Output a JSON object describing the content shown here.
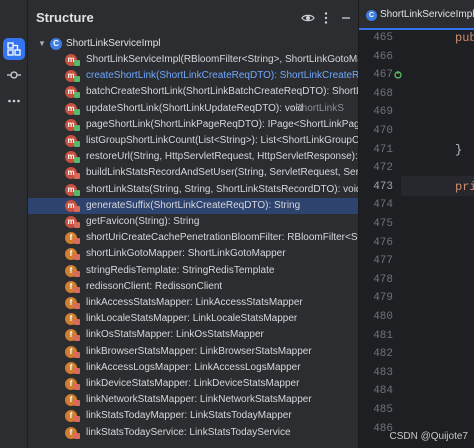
{
  "panel": {
    "title": "Structure"
  },
  "tree": {
    "root": {
      "label": "ShortLinkServiceImpl",
      "icon": "class-icon"
    },
    "items": [
      {
        "label": "ShortLinkServiceImpl(RBloomFilter<String>, ShortLinkGotoMapp",
        "icon": "method-icon",
        "kind": "m",
        "visibility": "public"
      },
      {
        "label": "createShortLink(ShortLinkCreateReqDTO): ShortLinkCreateResp",
        "icon": "method-icon",
        "kind": "m",
        "visibility": "public",
        "highlight": true
      },
      {
        "label": "batchCreateShortLink(ShortLinkBatchCreateReqDTO): ShortLink",
        "icon": "method-icon",
        "kind": "m",
        "visibility": "public"
      },
      {
        "label": "updateShortLink(ShortLinkUpdateReqDTO): void",
        "suffix": "↑ShortLinkS",
        "icon": "method-icon",
        "kind": "m",
        "visibility": "public"
      },
      {
        "label": "pageShortLink(ShortLinkPageReqDTO): IPage<ShortLinkPageRe",
        "icon": "method-icon",
        "kind": "m",
        "visibility": "public"
      },
      {
        "label": "listGroupShortLinkCount(List<String>): List<ShortLinkGroupCou",
        "icon": "method-icon",
        "kind": "m",
        "visibility": "public"
      },
      {
        "label": "restoreUrl(String, HttpServletRequest, HttpServletResponse): v",
        "icon": "method-icon",
        "kind": "m",
        "visibility": "public"
      },
      {
        "label": "buildLinkStatsRecordAndSetUser(String, ServletRequest, Servle",
        "icon": "method-icon",
        "kind": "m",
        "visibility": "private"
      },
      {
        "label": "shortLinkStats(String, String, ShortLinkStatsRecordDTO): void",
        "icon": "method-icon",
        "kind": "m",
        "visibility": "public"
      },
      {
        "label": "generateSuffix(ShortLinkCreateReqDTO): String",
        "icon": "method-icon",
        "kind": "m",
        "visibility": "private",
        "selected": true
      },
      {
        "label": "getFavicon(String): String",
        "icon": "method-icon",
        "kind": "m",
        "visibility": "private"
      },
      {
        "label": "shortUriCreateCachePenetrationBloomFilter: RBloomFilter<String",
        "icon": "field-icon",
        "kind": "f",
        "visibility": "private"
      },
      {
        "label": "shortLinkGotoMapper: ShortLinkGotoMapper",
        "icon": "field-icon",
        "kind": "f",
        "visibility": "private"
      },
      {
        "label": "stringRedisTemplate: StringRedisTemplate",
        "icon": "field-icon",
        "kind": "f",
        "visibility": "private"
      },
      {
        "label": "redissonClient: RedissonClient",
        "icon": "field-icon",
        "kind": "f",
        "visibility": "private"
      },
      {
        "label": "linkAccessStatsMapper: LinkAccessStatsMapper",
        "icon": "field-icon",
        "kind": "f",
        "visibility": "private"
      },
      {
        "label": "linkLocaleStatsMapper: LinkLocaleStatsMapper",
        "icon": "field-icon",
        "kind": "f",
        "visibility": "private"
      },
      {
        "label": "linkOsStatsMapper: LinkOsStatsMapper",
        "icon": "field-icon",
        "kind": "f",
        "visibility": "private"
      },
      {
        "label": "linkBrowserStatsMapper: LinkBrowserStatsMapper",
        "icon": "field-icon",
        "kind": "f",
        "visibility": "private"
      },
      {
        "label": "linkAccessLogsMapper: LinkAccessLogsMapper",
        "icon": "field-icon",
        "kind": "f",
        "visibility": "private"
      },
      {
        "label": "linkDeviceStatsMapper: LinkDeviceStatsMapper",
        "icon": "field-icon",
        "kind": "f",
        "visibility": "private"
      },
      {
        "label": "linkNetworkStatsMapper: LinkNetworkStatsMapper",
        "icon": "field-icon",
        "kind": "f",
        "visibility": "private"
      },
      {
        "label": "linkStatsTodayMapper: LinkStatsTodayMapper",
        "icon": "field-icon",
        "kind": "f",
        "visibility": "private"
      },
      {
        "label": "linkStatsTodayService: LinkStatsTodayService",
        "icon": "field-icon",
        "kind": "f",
        "visibility": "private"
      }
    ]
  },
  "editor": {
    "tab_label": "ShortLinkServiceImpl.ja",
    "lines": [
      {
        "num": "465",
        "code": "pub"
      },
      {
        "num": "466",
        "code": ""
      },
      {
        "num": "467",
        "code": ""
      },
      {
        "num": "468",
        "code": ""
      },
      {
        "num": "469",
        "code": ""
      },
      {
        "num": "470",
        "code": ""
      },
      {
        "num": "471",
        "code": "}"
      },
      {
        "num": "472",
        "code": ""
      },
      {
        "num": "473",
        "code": "pri"
      },
      {
        "num": "474",
        "code": ""
      },
      {
        "num": "475",
        "code": ""
      },
      {
        "num": "476",
        "code": ""
      },
      {
        "num": "477",
        "code": ""
      },
      {
        "num": "478",
        "code": ""
      },
      {
        "num": "479",
        "code": ""
      },
      {
        "num": "480",
        "code": ""
      },
      {
        "num": "481",
        "code": ""
      },
      {
        "num": "482",
        "code": ""
      },
      {
        "num": "483",
        "code": ""
      },
      {
        "num": "484",
        "code": ""
      },
      {
        "num": "485",
        "code": ""
      },
      {
        "num": "486",
        "code": ""
      }
    ]
  },
  "watermark": "CSDN @Quijote7",
  "colors": {
    "accent": "#3574f0",
    "selection": "#2e436e",
    "method": "#c9503f",
    "field": "#d07f2e"
  }
}
